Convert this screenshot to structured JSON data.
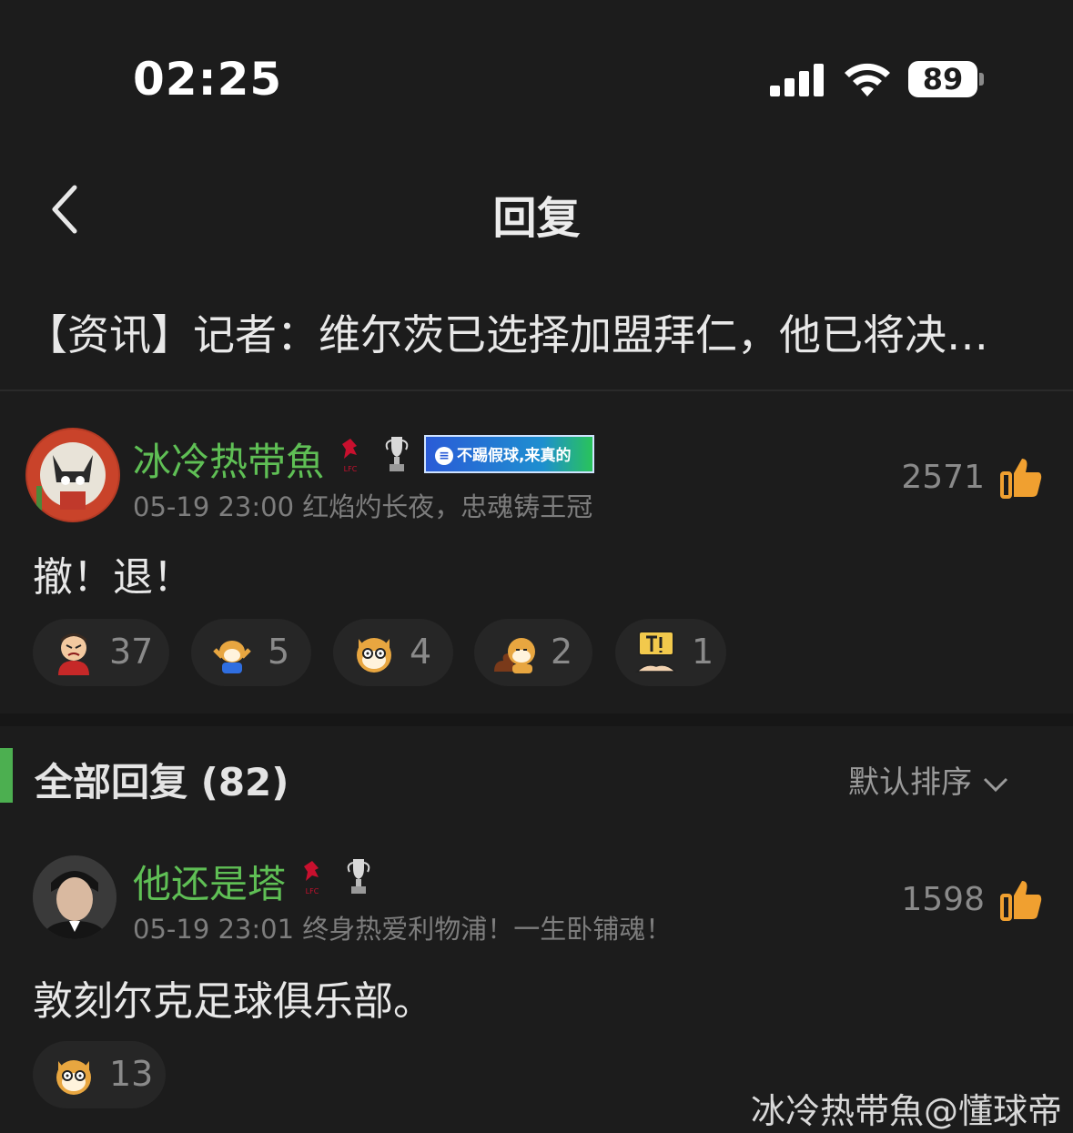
{
  "status_bar": {
    "time": "02:25",
    "battery": "89"
  },
  "header": {
    "title": "回复"
  },
  "topic": {
    "text": "【资讯】记者：维尔茨已选择加盟拜仁，他已将决…"
  },
  "main_comment": {
    "username": "冰冷热带魚",
    "badge_text": "不踢假球,来真的",
    "timestamp": "05-19 23:00",
    "signature": "红焰灼长夜，忠魂铸王冠",
    "likes": "2571",
    "content": "撤！退！",
    "reactions": [
      {
        "emoji": "angry-face",
        "count": "37"
      },
      {
        "emoji": "shiba-cheer",
        "count": "5"
      },
      {
        "emoji": "shiba-stare",
        "count": "4"
      },
      {
        "emoji": "shiba-poop",
        "count": "2"
      },
      {
        "emoji": "sign-shock",
        "count": "1"
      }
    ]
  },
  "replies_section": {
    "title": "全部回复 (82)",
    "sort_label": "默认排序"
  },
  "reply": {
    "username": "他还是塔",
    "timestamp": "05-19 23:01",
    "signature": "终身热爱利物浦！一生卧铺魂！",
    "likes": "1598",
    "content": "敦刻尔克足球俱乐部。",
    "reactions": [
      {
        "emoji": "shiba-stare",
        "count": "13"
      }
    ]
  },
  "watermark": "冰冷热带魚@懂球帝",
  "colors": {
    "background": "#1c1c1c",
    "username": "#5fbf55",
    "accent_bar": "#4caf50",
    "thumb": "#f0a030"
  }
}
